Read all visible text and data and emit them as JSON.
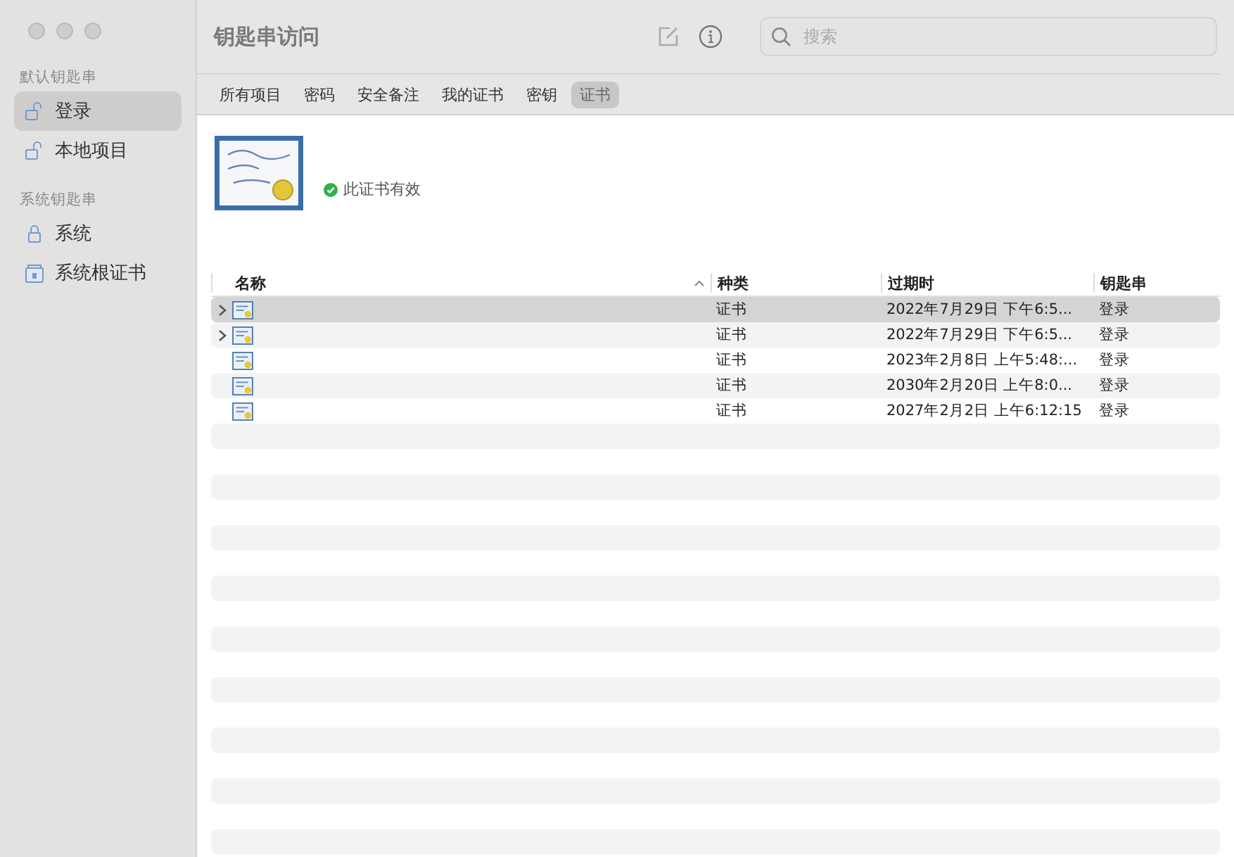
{
  "window": {
    "title": "钥匙串访问"
  },
  "sidebar": {
    "sections": [
      {
        "title": "默认钥匙串",
        "items": [
          {
            "label": "登录",
            "kind": "unlocked",
            "selected": true
          },
          {
            "label": "本地项目",
            "kind": "unlocked",
            "selected": false
          }
        ]
      },
      {
        "title": "系统钥匙串",
        "items": [
          {
            "label": "系统",
            "kind": "locked",
            "selected": false
          },
          {
            "label": "系统根证书",
            "kind": "cabinet",
            "selected": false
          }
        ]
      }
    ]
  },
  "search": {
    "placeholder": "搜索"
  },
  "tabs": [
    {
      "label": "所有项目",
      "selected": false
    },
    {
      "label": "密码",
      "selected": false
    },
    {
      "label": "安全备注",
      "selected": false
    },
    {
      "label": "我的证书",
      "selected": false
    },
    {
      "label": "密钥",
      "selected": false
    },
    {
      "label": "证书",
      "selected": true
    }
  ],
  "detail": {
    "status": "此证书有效",
    "valid": true
  },
  "table": {
    "columns": [
      "名称",
      "种类",
      "过期时",
      "钥匙串"
    ],
    "rows": [
      {
        "expandable": true,
        "selected": true,
        "kind": "证书",
        "expires": "2022年7月29日 下午6:5...",
        "keychain": "登录"
      },
      {
        "expandable": true,
        "selected": false,
        "kind": "证书",
        "expires": "2022年7月29日 下午6:5...",
        "keychain": "登录"
      },
      {
        "expandable": false,
        "selected": false,
        "kind": "证书",
        "expires": "2023年2月8日 上午5:48:...",
        "keychain": "登录"
      },
      {
        "expandable": false,
        "selected": false,
        "kind": "证书",
        "expires": "2030年2月20日 上午8:0...",
        "keychain": "登录"
      },
      {
        "expandable": false,
        "selected": false,
        "kind": "证书",
        "expires": "2027年2月2日 上午6:12:15",
        "keychain": "登录"
      }
    ]
  }
}
